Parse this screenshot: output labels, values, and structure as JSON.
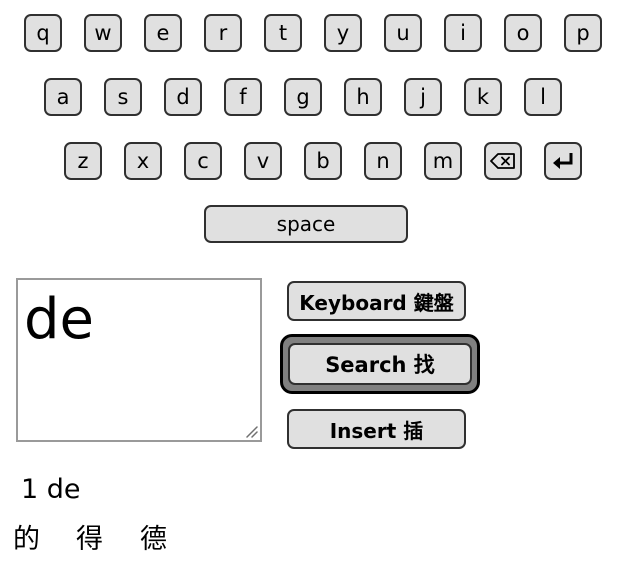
{
  "keyboard": {
    "row1": [
      "q",
      "w",
      "e",
      "r",
      "t",
      "y",
      "u",
      "i",
      "o",
      "p"
    ],
    "row2": [
      "a",
      "s",
      "d",
      "f",
      "g",
      "h",
      "j",
      "k",
      "l"
    ],
    "row3": [
      "z",
      "x",
      "c",
      "v",
      "b",
      "n",
      "m"
    ],
    "space_label": "space"
  },
  "input": {
    "value": "de"
  },
  "buttons": {
    "keyboard_label": "Keyboard 鍵盤",
    "search_label": "Search 找",
    "insert_label": "Insert 插"
  },
  "results": {
    "heading": "1 de",
    "candidates": [
      "的",
      "得",
      "德"
    ]
  }
}
